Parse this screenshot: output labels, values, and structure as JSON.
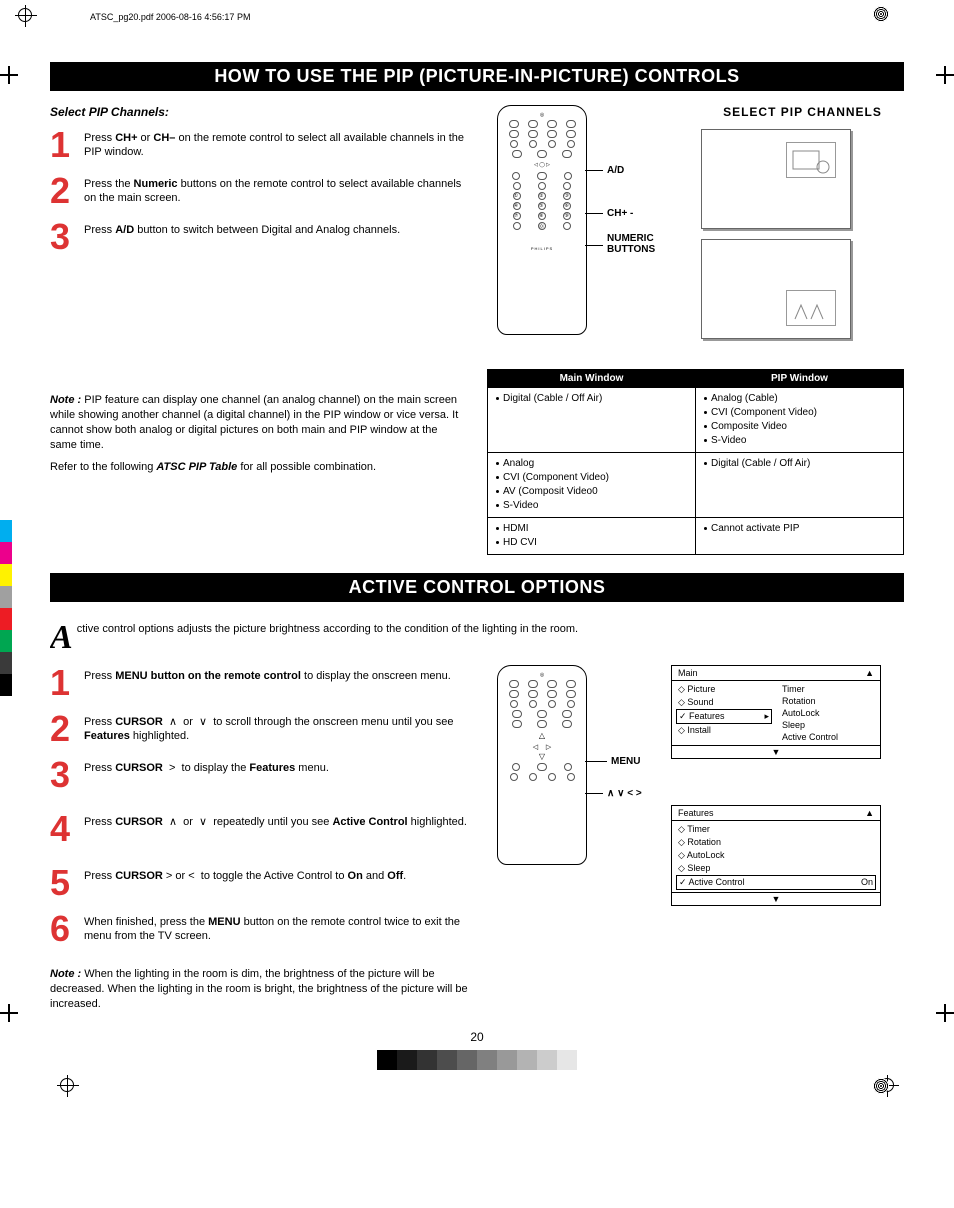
{
  "header": {
    "filename": "ATSC_pg20.pdf  2006-08-16  4:56:17 PM"
  },
  "page_number": "20",
  "section1": {
    "title": "HOW TO USE THE PIP (PICTURE-IN-PICTURE) CONTROLS",
    "subhead": "Select PIP Channels:",
    "steps": [
      {
        "n": "1",
        "html": "Press <b>CH+</b> or <b>CH–</b> on the remote control to select all available channels in the PIP window."
      },
      {
        "n": "2",
        "html": "Press the <b>Numeric</b> buttons on the remote control to select available channels on the main screen."
      },
      {
        "n": "3",
        "html": "Press <b>A/D</b> button to switch between Digital and Analog channels."
      }
    ],
    "note": "<b>Note :</b> PIP feature can display one channel (an analog channel) on the main screen while showing another channel (a digital channel) in the PIP window or vice versa. It cannot show both analog or digital pictures on both main and PIP window at the same time.",
    "note2": "Refer to the following <b>ATSC PIP Table</b> for all possible combination.",
    "callouts": {
      "ad": "A/D",
      "ch": "CH+  -",
      "num": "NUMERIC BUTTONS"
    },
    "right_title": "SELECT PIP CHANNELS",
    "table": {
      "h1": "Main Window",
      "h2": "PIP Window",
      "rows": [
        {
          "l": [
            "Digital (Cable / Off Air)"
          ],
          "r": [
            "Analog (Cable)",
            "CVI (Component Video)",
            "Composite Video",
            "S-Video"
          ]
        },
        {
          "l": [
            "Analog",
            "CVI (Component Video)",
            "AV (Composit Video0",
            "S-Video"
          ],
          "r": [
            "Digital (Cable / Off Air)"
          ]
        },
        {
          "l": [
            "HDMI",
            "HD CVI"
          ],
          "r": [
            "Cannot activate PIP"
          ]
        }
      ]
    }
  },
  "section2": {
    "title": "ACTIVE CONTROL OPTIONS",
    "dropcap": "A",
    "intro": "ctive control options adjusts the picture brightness according to the condition of the lighting in the room.",
    "steps": [
      {
        "n": "1",
        "html": "Press <b>MENU button on the remote control</b> to display the onscreen menu."
      },
      {
        "n": "2",
        "html": "Press <b>CURSOR</b> &nbsp;∧&nbsp; or &nbsp;∨&nbsp; to scroll through the onscreen menu until you see <b>Features</b> highlighted."
      },
      {
        "n": "3",
        "html": "Press <b>CURSOR</b> &nbsp;&gt;&nbsp; to display the <b>Features</b> menu."
      },
      {
        "n": "4",
        "html": "Press <b>CURSOR</b> &nbsp;∧&nbsp; or &nbsp;∨&nbsp; repeatedly until you see <b>Active Control</b> highlighted."
      },
      {
        "n": "5",
        "html": "Press <b>CURSOR</b> &gt; or &lt;&nbsp; to toggle the Active Control to <b>On</b> and <b>Off</b>."
      },
      {
        "n": "6",
        "html": "When finished, press the <b>MENU</b> button on the remote control twice to exit the menu from the TV screen."
      }
    ],
    "note": "<b>Note :</b> When the lighting in the room is dim, the brightness of the picture will be decreased.  When the lighting in the room is bright, the brightness of the picture will be increased.",
    "callouts": {
      "menu": "MENU",
      "arrows": "∧  ∨  <  >"
    },
    "menu1": {
      "title": "Main",
      "left": [
        "◇ Picture",
        "◇ Sound",
        "✓ Features",
        "◇ Install"
      ],
      "right": [
        "Timer",
        "Rotation",
        "AutoLock",
        "Sleep",
        "Active Control"
      ],
      "sel_idx": 2
    },
    "menu2": {
      "title": "Features",
      "left": [
        "◇ Timer",
        "◇ Rotation",
        "◇ AutoLock",
        "◇ Sleep",
        "✓ Active Control"
      ],
      "right_last": "On",
      "sel_idx": 4
    }
  },
  "remote_brand": "PHILIPS",
  "colors": {
    "swatches": [
      "#000000",
      "#1a1a1a",
      "#333333",
      "#4d4d4d",
      "#666666",
      "#808080",
      "#999999",
      "#b3b3b3",
      "#cccccc",
      "#e6e6e6"
    ],
    "side": [
      "#00aeef",
      "#ec008c",
      "#fff200",
      "#a0a0a0",
      "#ed1c24",
      "#00a651",
      "#3a3a3a",
      "#000000"
    ]
  }
}
